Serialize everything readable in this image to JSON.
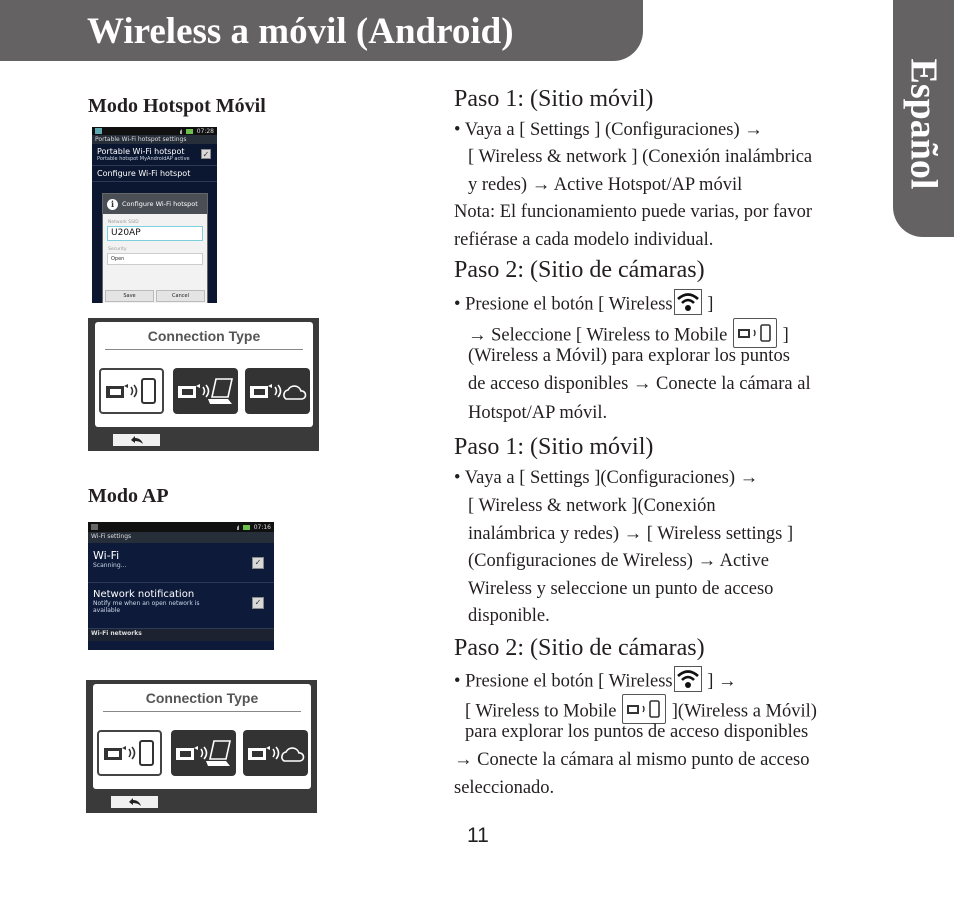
{
  "header": {
    "title": "Wireless a móvil (Android)"
  },
  "language_tab": {
    "label": "Español"
  },
  "left": {
    "hotspot_heading": "Modo Hotspot Móvil",
    "ap_heading": "Modo AP",
    "hotspot_screen": {
      "time": "07:28",
      "subtitle": "Portable Wi-Fi hotspot settings",
      "pref1_title": "Portable Wi-Fi hotspot",
      "pref1_sub": "Portable hotspot MyAndroidAP active",
      "pref2_title": "Configure Wi-Fi hotspot",
      "dialog_title": "Configure Wi-Fi hotspot",
      "ssid_label": "Network SSID",
      "ssid_value": "U20AP",
      "security_label": "Security",
      "security_value": "Open",
      "save": "Save",
      "cancel": "Cancel"
    },
    "ap_screen": {
      "time": "07:16",
      "subtitle": "Wi-Fi settings",
      "wifi_title": "Wi-Fi",
      "wifi_sub": "Scanning...",
      "notif_title": "Network notification",
      "notif_sub": "Notify me when an open network is available",
      "networks_label": "Wi-Fi networks"
    },
    "connection_panel": {
      "title": "Connection Type",
      "options": [
        "wireless-to-mobile",
        "wireless-to-pc",
        "wireless-to-cloud"
      ],
      "selected": "wireless-to-mobile"
    }
  },
  "right": {
    "hotspot": {
      "step1_heading": "Paso 1: (Sitio móvil)",
      "step1_lines": [
        "• Vaya a [ Settings ] (Configuraciones) →",
        "[ Wireless & network ] (Conexión inalámbrica",
        "y redes) → Active Hotspot/AP móvil"
      ],
      "note_lines": [
        "Nota: El funcionamiento puede varias, por favor",
        "refiérase a cada modelo individual."
      ],
      "step2_heading": "Paso 2: (Sitio de cámaras)",
      "step2_l1a": "• Presione el botón [ Wireless",
      "step2_l1b": " ]",
      "step2_l2a": "→ Seleccione [ Wireless to Mobile ",
      "step2_l2b": " ]",
      "step2_rest": [
        "(Wireless a Móvil) para explorar los puntos",
        "de acceso disponibles → Conecte la cámara al",
        "Hotspot/AP móvil."
      ]
    },
    "ap": {
      "step1_heading": "Paso 1: (Sitio móvil)",
      "step1_lines": [
        "• Vaya a [ Settings ](Configuraciones) →",
        "[ Wireless & network ](Conexión",
        "inalámbrica y redes) → [ Wireless settings ]",
        "(Configuraciones de Wireless) → Active",
        "Wireless y seleccione un punto de acceso",
        "disponible."
      ],
      "step2_heading": "Paso 2: (Sitio de cámaras)",
      "step2_l1a": "• Presione el botón [ Wireless",
      "step2_l1b": " ]  →",
      "step2_l2a": "[ Wireless to Mobile ",
      "step2_l2b": " ](Wireless a Móvil)",
      "step2_rest": [
        "para explorar los puntos de acceso disponibles",
        "→ Conecte la cámara al mismo punto de acceso",
        "seleccionado."
      ]
    }
  },
  "page_number": "11"
}
